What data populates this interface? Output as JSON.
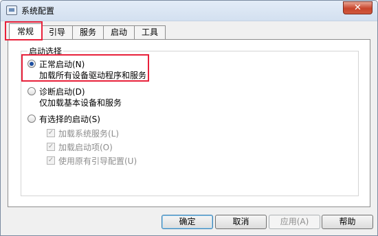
{
  "window": {
    "title": "系统配置",
    "close_glyph": "✕"
  },
  "tabs": [
    {
      "label": "常规",
      "active": true
    },
    {
      "label": "引导",
      "active": false
    },
    {
      "label": "服务",
      "active": false
    },
    {
      "label": "启动",
      "active": false
    },
    {
      "label": "工具",
      "active": false
    }
  ],
  "startup_selection": {
    "group_label": "启动选择",
    "normal": {
      "label": "正常启动(N)",
      "description": "加载所有设备驱动程序和服务",
      "selected": true
    },
    "diagnostic": {
      "label": "诊断启动(D)",
      "description": "仅加载基本设备和服务",
      "selected": false
    },
    "selective": {
      "label": "有选择的启动(S)",
      "selected": false
    },
    "options": [
      {
        "label": "加载系统服务(L)",
        "checked": true
      },
      {
        "label": "加载启动项(O)",
        "checked": true
      },
      {
        "label": "使用原有引导配置(U)",
        "checked": true
      }
    ]
  },
  "buttons": {
    "ok": "确定",
    "cancel": "取消",
    "apply": "应用(A)",
    "help": "帮助"
  },
  "colors": {
    "highlight": "#e8203a",
    "radio_dot": "#1e4fa0"
  },
  "icons": {
    "app": "msconfig-icon",
    "close": "close-icon",
    "checkmark": "checkmark-icon"
  }
}
